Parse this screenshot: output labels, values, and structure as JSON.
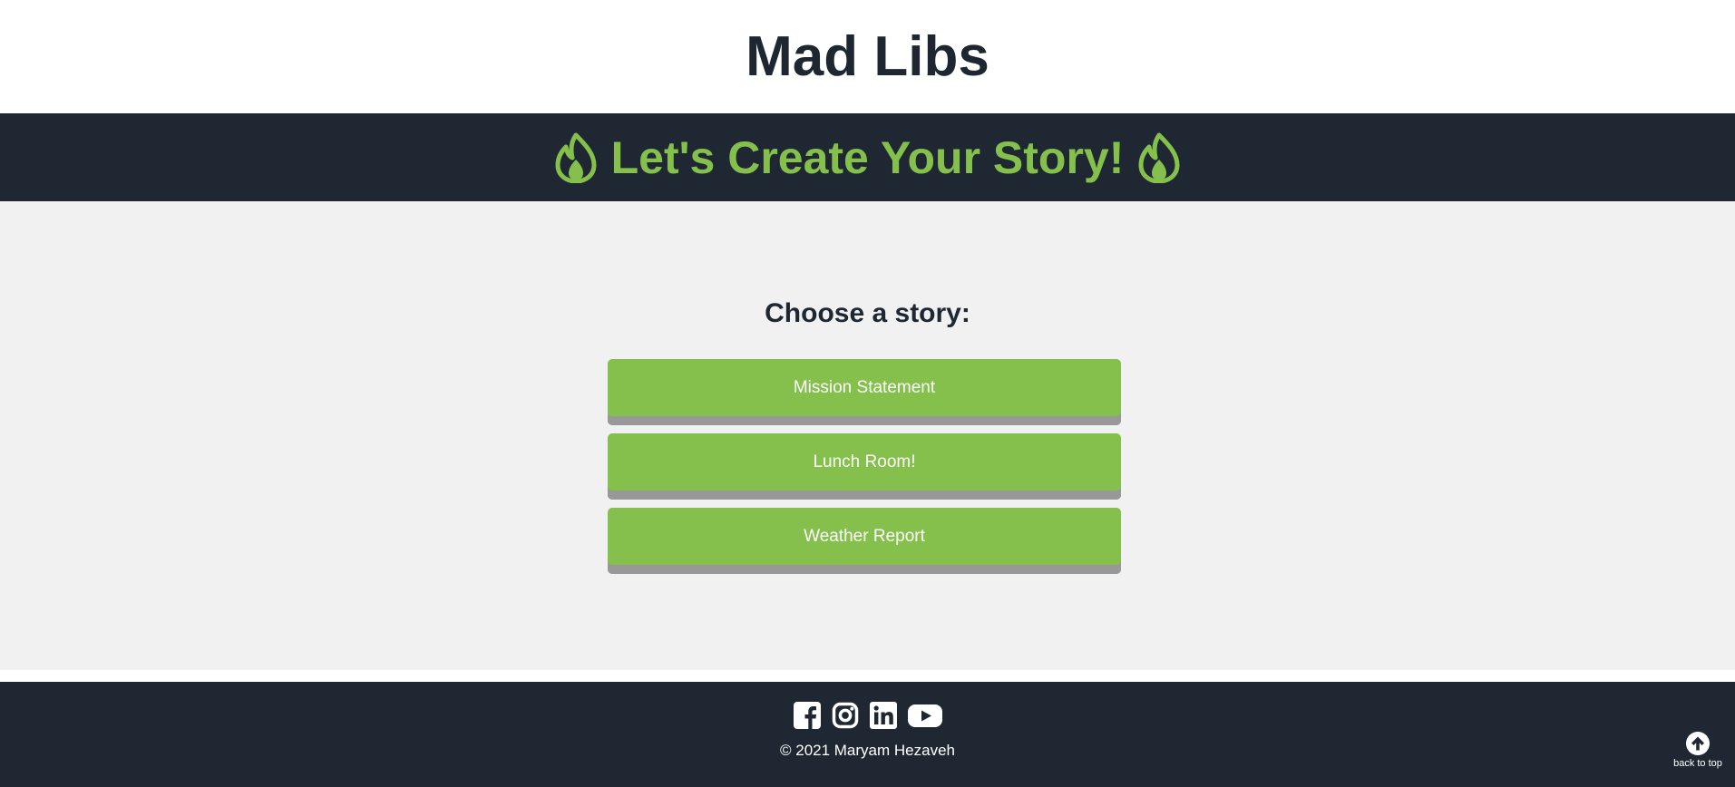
{
  "header": {
    "title": "Mad Libs"
  },
  "banner": {
    "title": "Let's Create Your Story!",
    "icon": "flame-icon",
    "accent_color": "#84c04b"
  },
  "main": {
    "heading": "Choose a story:",
    "stories": [
      {
        "label": "Mission Statement"
      },
      {
        "label": "Lunch Room!"
      },
      {
        "label": "Weather Report"
      }
    ],
    "button_color": "#84c04b"
  },
  "footer": {
    "social_icons": [
      "facebook-icon",
      "instagram-icon",
      "linkedin-icon",
      "youtube-icon"
    ],
    "copyright": "© 2021 Maryam Hezaveh",
    "back_to_top": "back to top",
    "back_to_top_icon": "arrow-up-circle-icon"
  }
}
